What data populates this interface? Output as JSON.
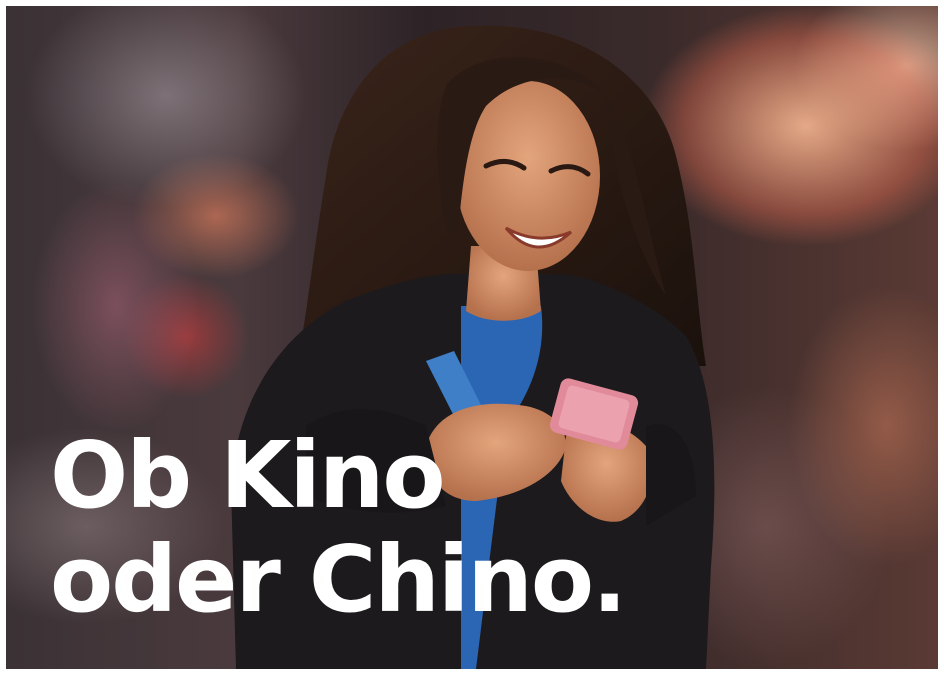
{
  "headline": {
    "line1": "Ob Kino",
    "line2": "oder Chino."
  },
  "photo": {
    "subject": "woman-smiling-at-smartphone",
    "colors": {
      "jacket": "#1c1a1c",
      "shirt": "#2b66b4",
      "strap": "#3f7fc8",
      "phone": "#e08a9a",
      "hair": "#2a1a14",
      "skin": "#c98a63"
    }
  }
}
